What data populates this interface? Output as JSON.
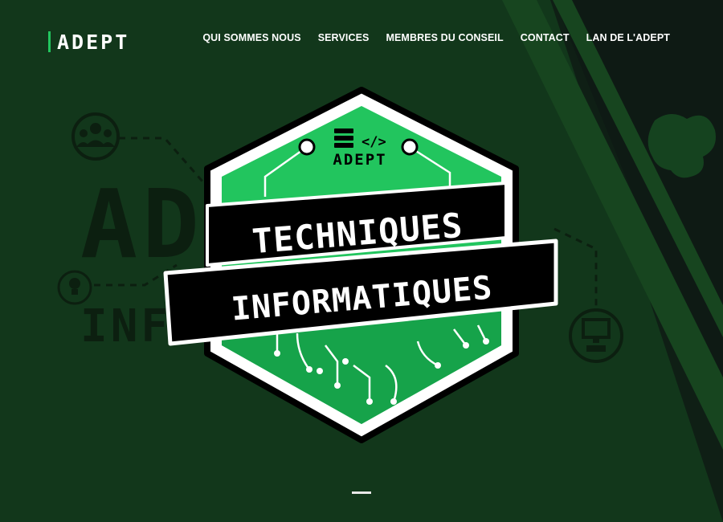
{
  "brand": {
    "logo_text": "ADEPT"
  },
  "nav": {
    "items": [
      {
        "label": "QUI SOMMES NOUS"
      },
      {
        "label": "SERVICES"
      },
      {
        "label": "MEMBRES DU CONSEIL"
      },
      {
        "label": "CONTACT"
      },
      {
        "label": "LAN DE L'ADEPT"
      }
    ]
  },
  "badge": {
    "brand_text": "ADEPT",
    "code_symbol": "</>",
    "line1": "TECHNIQUES",
    "line2": "INFORMATIQUES"
  },
  "background": {
    "watermark_large": "ADEPT",
    "watermark_small": "INF"
  },
  "colors": {
    "bg_green": "#12371b",
    "accent_green": "#22c55e",
    "dark_panel": "#0e1a14"
  },
  "icons": [
    "users-group-icon",
    "lightbulb-icon",
    "computer-icon",
    "mascot-icon",
    "server-icon",
    "code-icon"
  ]
}
